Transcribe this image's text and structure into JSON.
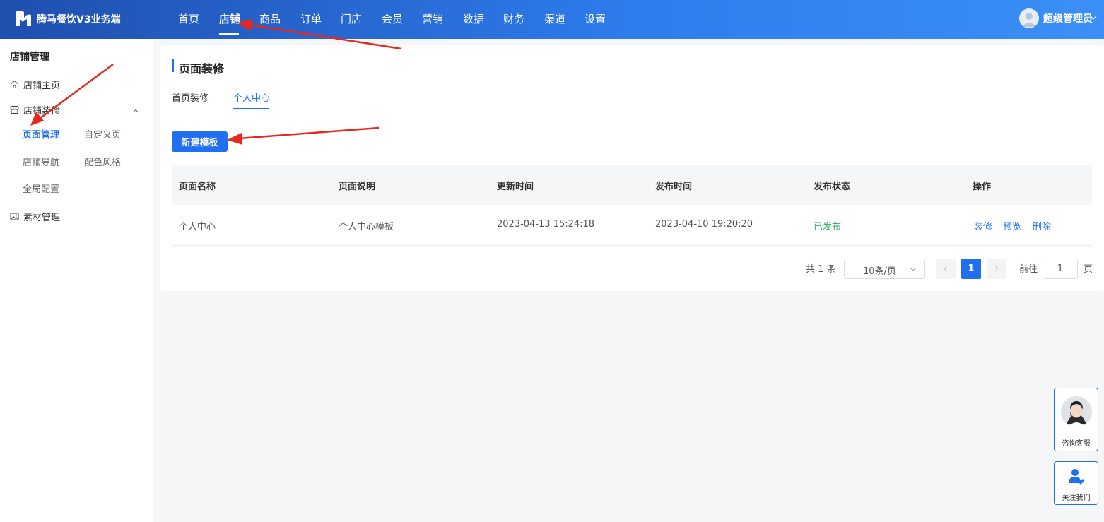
{
  "app": {
    "brand": "腾马餐饮V3业务端"
  },
  "topnav": {
    "items": [
      {
        "label": "首页"
      },
      {
        "label": "店铺"
      },
      {
        "label": "商品"
      },
      {
        "label": "订单"
      },
      {
        "label": "门店"
      },
      {
        "label": "会员"
      },
      {
        "label": "营销"
      },
      {
        "label": "数据"
      },
      {
        "label": "财务"
      },
      {
        "label": "渠道"
      },
      {
        "label": "设置"
      }
    ],
    "active": "店铺"
  },
  "user": {
    "name": "超级管理员"
  },
  "sidebar": {
    "title": "店铺管理",
    "items": [
      {
        "label": "店铺主页",
        "icon": "home-icon"
      },
      {
        "label": "店铺装修",
        "icon": "store-icon"
      },
      {
        "label": "素材管理",
        "icon": "image-icon"
      }
    ],
    "subitems": [
      {
        "label": "页面管理"
      },
      {
        "label": "自定义页"
      },
      {
        "label": "店铺导航"
      },
      {
        "label": "配色风格"
      },
      {
        "label": "全局配置"
      }
    ],
    "active_sub": "页面管理"
  },
  "main": {
    "title": "页面装修",
    "tabs": [
      {
        "label": "首页装修"
      },
      {
        "label": "个人中心"
      }
    ],
    "active_tab": "个人中心",
    "new_button": "新建模板",
    "table": {
      "columns": [
        "页面名称",
        "页面说明",
        "更新时间",
        "发布时间",
        "发布状态",
        "操作"
      ],
      "rows": [
        {
          "name": "个人中心",
          "desc": "个人中心模板",
          "updated": "2023-04-13 15:24:18",
          "published": "2023-04-10 19:20:20",
          "status": "已发布",
          "actions": [
            "装修",
            "预览",
            "删除"
          ]
        }
      ]
    },
    "pagination": {
      "total": "共 1 条",
      "page_size": "10条/页",
      "current": "1",
      "goto_label": "前往",
      "goto_value": "1",
      "page_suffix": "页"
    }
  },
  "floating": {
    "service_label": "咨询客服",
    "follow_label": "关注我们"
  },
  "colors": {
    "primary": "#1f6ff0",
    "published": "#3cb371",
    "annotation_arrow": "#e8281e"
  }
}
